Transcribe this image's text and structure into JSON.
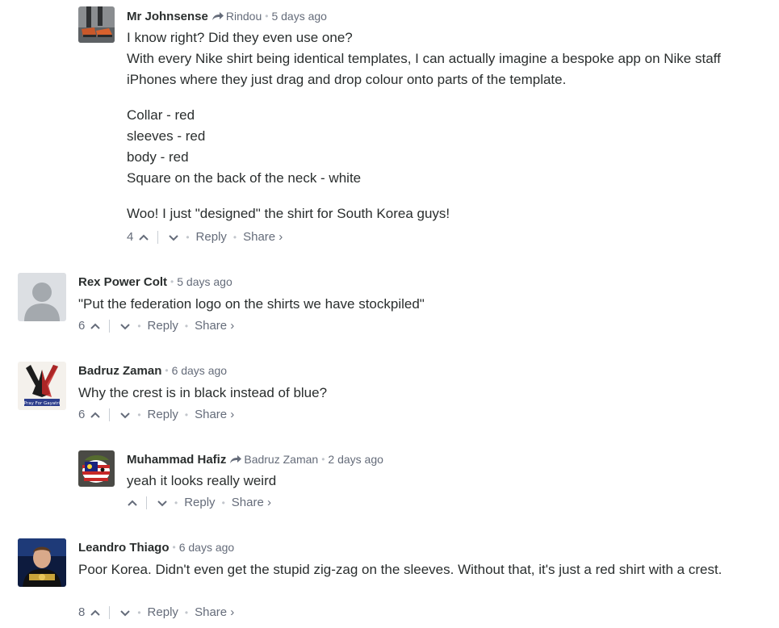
{
  "comments": [
    {
      "author": "Mr Johnsense",
      "reply_to": "Rindou",
      "time": "5 days ago",
      "paragraphs": [
        [
          "I know right? Did they even use one?",
          "With every Nike shirt being identical templates, I can actually imagine a bespoke app on Nike staff iPhones where they just drag and drop colour onto parts of the template."
        ],
        [
          "Collar - red",
          "sleeves - red",
          "body - red",
          "Square on the back of the neck - white"
        ],
        [
          "Woo! I just \"designed\" the shirt for South Korea guys!"
        ]
      ],
      "votes": "4",
      "reply": "Reply",
      "share": "Share ›"
    },
    {
      "author": "Rex Power Colt",
      "time": "5 days ago",
      "text": "\"Put the federation logo on the shirts we have stockpiled\"",
      "votes": "6",
      "reply": "Reply",
      "share": "Share ›"
    },
    {
      "author": "Badruz Zaman",
      "time": "6 days ago",
      "text": "Why the crest is in black instead of blue?",
      "votes": "6",
      "avatar_caption": "Pray For Gayatri",
      "reply": "Reply",
      "share": "Share ›"
    },
    {
      "author": "Muhammad Hafiz",
      "reply_to": "Badruz Zaman",
      "time": "2 days ago",
      "text": "yeah it looks really weird",
      "votes": "",
      "reply": "Reply",
      "share": "Share ›"
    },
    {
      "author": "Leandro Thiago",
      "time": "6 days ago",
      "text": "Poor Korea. Didn't even get the stupid zig-zag on the sleeves. Without that, it's just a red shirt with a crest.",
      "votes": "8",
      "reply": "Reply",
      "share": "Share ›"
    }
  ],
  "icons": {
    "upvote": "chevron-up-icon",
    "downvote": "chevron-down-icon",
    "reply_arrow": "reply-arrow-icon"
  },
  "colors": {
    "text": "#2a2e2e",
    "meta": "#656c7a",
    "separator": "#c2c6cc"
  }
}
